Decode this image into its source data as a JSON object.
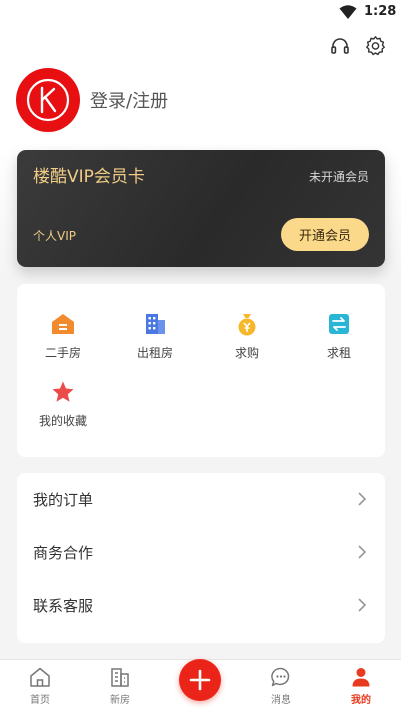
{
  "status_bar": {
    "time": "1:28"
  },
  "profile": {
    "login_label": "登录/注册"
  },
  "vip_card": {
    "title": "楼酷VIP会员卡",
    "status": "未开通会员",
    "type": "个人VIP",
    "button_label": "开通会员",
    "colors": {
      "title": "#f0cc86",
      "button": "#fbd98a"
    }
  },
  "services": [
    {
      "label": "二手房",
      "icon": "house-icon",
      "color": "#f28a2e"
    },
    {
      "label": "出租房",
      "icon": "building-icon",
      "color": "#4a78e0"
    },
    {
      "label": "求购",
      "icon": "money-bag-icon",
      "color": "#f6b72a"
    },
    {
      "label": "求租",
      "icon": "swap-icon",
      "color": "#29b6d6"
    },
    {
      "label": "我的收藏",
      "icon": "star-icon",
      "color": "#ec4b4b"
    }
  ],
  "menu": [
    {
      "label": "我的订单"
    },
    {
      "label": "商务合作"
    },
    {
      "label": "联系客服"
    }
  ],
  "tabs": [
    {
      "label": "首页",
      "icon": "home-icon"
    },
    {
      "label": "新房",
      "icon": "new-building-icon"
    },
    {
      "label": "消息",
      "icon": "message-icon"
    },
    {
      "label": "我的",
      "icon": "person-icon",
      "active": true
    }
  ],
  "accent_color": "#ea2418"
}
